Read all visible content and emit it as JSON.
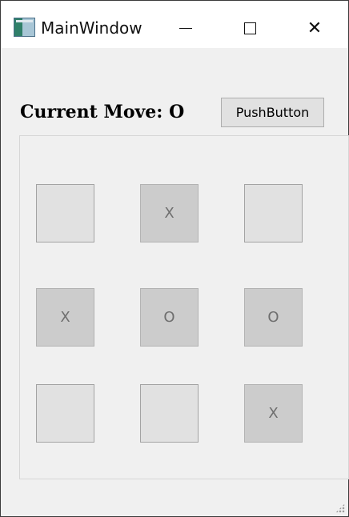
{
  "window": {
    "title": "MainWindow",
    "icon": "app-window-icon",
    "controls": {
      "minimize": "minimize-icon",
      "maximize": "maximize-icon",
      "close_glyph": "✕"
    }
  },
  "header": {
    "current_move_label": "Current Move: O",
    "push_button_label": "PushButton"
  },
  "board": {
    "cells": [
      {
        "value": ""
      },
      {
        "value": "X"
      },
      {
        "value": ""
      },
      {
        "value": "X"
      },
      {
        "value": "O"
      },
      {
        "value": "O"
      },
      {
        "value": ""
      },
      {
        "value": ""
      },
      {
        "value": "X"
      }
    ]
  },
  "colors": {
    "empty_cell": "#e1e1e1",
    "filled_cell": "#cccccc",
    "window_bg": "#f0f0f0"
  }
}
